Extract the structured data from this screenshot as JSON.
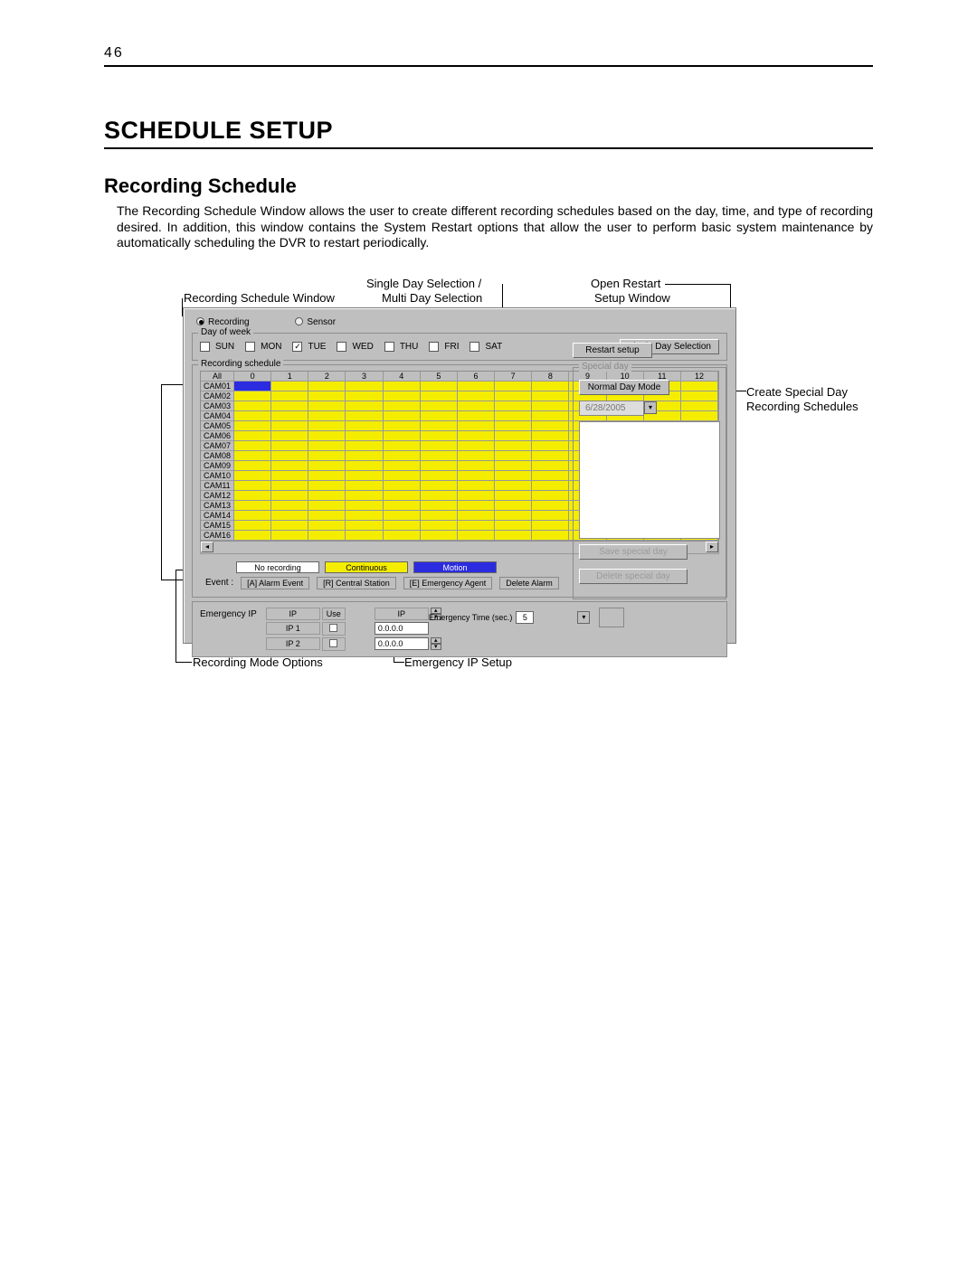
{
  "page_number": "46",
  "heading": "SCHEDULE SETUP",
  "subheading": "Recording Schedule",
  "body": "The Recording Schedule Window allows the user to create different recording schedules based on the day, time, and type of recording desired. In addition, this window contains the System Restart options that allow the user to perform basic system maintenance by automatically scheduling the DVR to restart periodically.",
  "annotations": {
    "rec_window": "Recording Schedule Window",
    "single_multi": "Single Day Selection /",
    "single_multi_2": "Multi Day Selection",
    "open_restart": "Open Restart",
    "open_restart_2": "Setup Window",
    "create_special": "Create Special Day",
    "create_special_2": "Recording Schedules",
    "rec_mode": "Recording Mode Options",
    "emerg_ip": "Emergency IP Setup"
  },
  "win": {
    "radio_recording": "Recording",
    "radio_sensor": "Sensor",
    "group_day": "Day of week",
    "days": [
      "SUN",
      "MON",
      "TUE",
      "WED",
      "THU",
      "FRI",
      "SAT"
    ],
    "btn_single_day": "Single Day Selection",
    "btn_restart": "Restart setup",
    "group_sched": "Recording schedule",
    "hours": [
      "All",
      "0",
      "1",
      "2",
      "3",
      "4",
      "5",
      "6",
      "7",
      "8",
      "9",
      "10",
      "11",
      "12"
    ],
    "cams": [
      "CAM01",
      "CAM02",
      "CAM03",
      "CAM04",
      "CAM05",
      "CAM06",
      "CAM07",
      "CAM08",
      "CAM09",
      "CAM10",
      "CAM11",
      "CAM12",
      "CAM13",
      "CAM14",
      "CAM15",
      "CAM16"
    ],
    "legend_no": "No recording",
    "legend_cont": "Continuous",
    "legend_motion": "Motion",
    "event_label": "Event :",
    "event_a": "[A] Alarm Event",
    "event_r": "[R] Central Station",
    "event_e": "[E] Emergency Agent",
    "event_del": "Delete Alarm",
    "ip_label": "Emergency IP",
    "ip_hdr_ip": "IP",
    "ip_hdr_use": "Use",
    "ip_hdr_ip2": "IP",
    "ip_rows": [
      "IP 1",
      "IP 2"
    ],
    "ip_default": "0.0.0.0",
    "emerg_time_label": "Emergency Time (sec.)",
    "emerg_time_val": "5",
    "group_special": "Special day",
    "btn_normal": "Normal Day Mode",
    "date_value": "6/28/2005",
    "btn_save_special": "Save special day",
    "btn_del_special": "Delete special day"
  }
}
